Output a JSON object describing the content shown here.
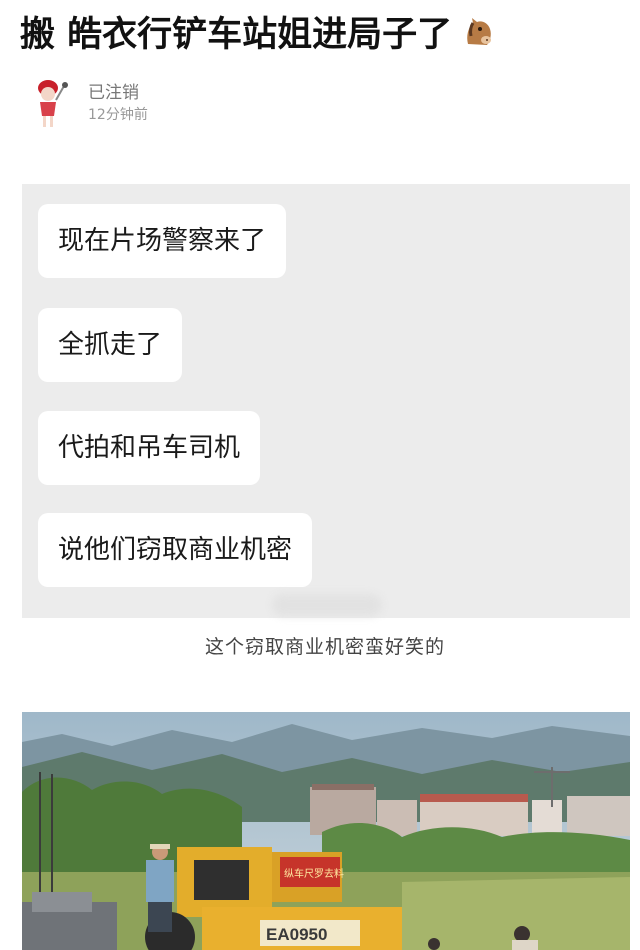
{
  "post": {
    "title": "搬 皓衣行铲车站姐进局子了",
    "title_emoji": "horse-face-emoji",
    "author": {
      "name": "已注销",
      "time": "12分钟前",
      "avatar": "cartoon-figure-avatar"
    }
  },
  "chat_screenshot": {
    "messages": [
      "现在片场警察来了",
      "全抓走了",
      "代拍和吊车司机",
      "说他们窃取商业机密"
    ]
  },
  "caption": "这个窃取商业机密蛮好笑的",
  "photo": {
    "description_icon": "construction-site-photo",
    "vehicle_sign_text": "纵车尺罗去料",
    "vehicle_plate_text": "EA0950"
  },
  "colors": {
    "title": "#111111",
    "meta": "#777777",
    "chat_background": "#ececec",
    "bubble": "#ffffff",
    "caption": "#444444"
  }
}
